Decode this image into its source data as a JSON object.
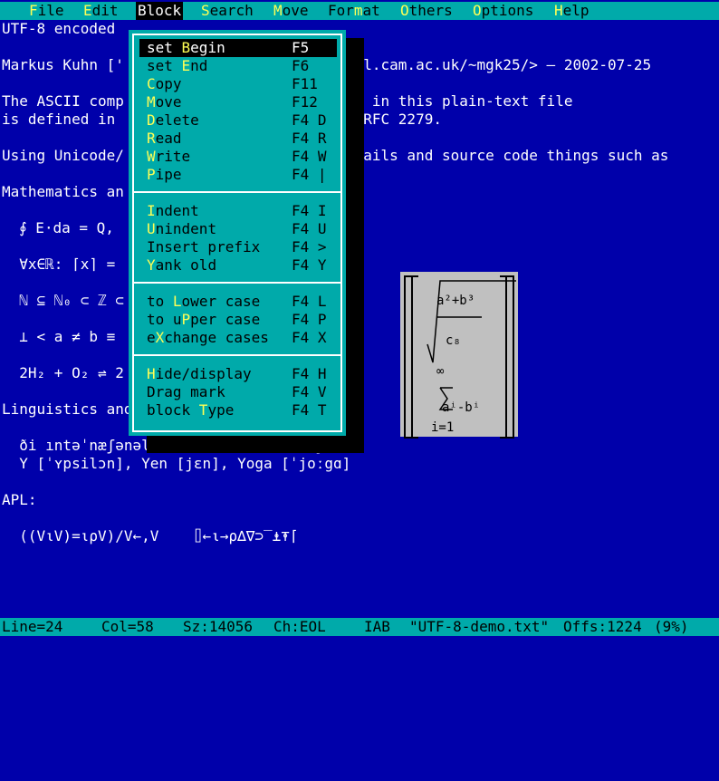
{
  "menubar": {
    "items": [
      {
        "pre": "",
        "hk": "F",
        "post": "ile"
      },
      {
        "pre": "",
        "hk": "E",
        "post": "dit"
      },
      {
        "pre": "",
        "hk": "B",
        "post": "lock"
      },
      {
        "pre": "",
        "hk": "S",
        "post": "earch"
      },
      {
        "pre": "",
        "hk": "M",
        "post": "ove"
      },
      {
        "pre": "For",
        "hk": "m",
        "post": "at"
      },
      {
        "pre": "",
        "hk": "O",
        "post": "thers"
      },
      {
        "pre": "",
        "hk": "O",
        "post": "ptions"
      },
      {
        "pre": "",
        "hk": "H",
        "post": "elp"
      }
    ],
    "active": "Block"
  },
  "document": {
    "lines": [
      "UTF-8 encoded",
      "",
      "Markus Kuhn ['",
      "",
      "The ASCII comp",
      "is defined in",
      "",
      "Using Unicode/",
      "",
      "Mathematics an",
      "",
      "  ∮ E⋅da = Q,",
      "",
      "  ∀x∈ℝ: ⌈x⌉ =",
      "",
      "  ℕ ⊆ ℕ₀ ⊂ ℤ ⊂",
      "",
      "  ⊥ < a ≠ b ≡",
      "",
      "  2H₂ + O₂ ⇌ 2",
      "",
      "Linguistics and dictionaries:",
      "",
      "  ði ıntəˈnæʃənəl fəˈnɛtık əsoʊsiˈeıʃn",
      "  Y [ˈʏpsilɔn], Yen [jɛn], Yoga [ˈjoːgɑ]",
      "",
      "APL:",
      "",
      "  ((V⍳V)=⍳⍴V)/V←,V    ⌷←⍳→⍴∆∇⊃‾⍎⍕⌈",
      ""
    ],
    "right_fragments": [
      {
        "row": 2,
        "text": ".cl.cam.ac.uk/~mgk25/> — 2002-07-25"
      },
      {
        "row": 4,
        "text": "ed in this plain-text file"
      },
      {
        "row": 5,
        "text": "d RFC 2279."
      },
      {
        "row": 7,
        "text": "emails and source code things such as"
      },
      {
        "row": 13,
        "text": "),"
      },
      {
        "row": 19,
        "text": "m"
      }
    ],
    "math_box": {
      "numerator": "a²+b³",
      "denominator": "c₈",
      "infinity": "∞",
      "sum_body": "aⁱ-bⁱ",
      "sum_lower": "i=1"
    }
  },
  "block_menu": {
    "groups": [
      [
        {
          "pre": "set ",
          "hk": "B",
          "post": "egin",
          "key": "F5",
          "selected": true
        },
        {
          "pre": "set ",
          "hk": "E",
          "post": "nd",
          "key": "F6"
        },
        {
          "pre": "",
          "hk": "C",
          "post": "opy",
          "key": "F11"
        },
        {
          "pre": "",
          "hk": "M",
          "post": "ove",
          "key": "F12"
        },
        {
          "pre": "",
          "hk": "D",
          "post": "elete",
          "key": "F4 D"
        },
        {
          "pre": "",
          "hk": "R",
          "post": "ead",
          "key": "F4 R"
        },
        {
          "pre": "",
          "hk": "W",
          "post": "rite",
          "key": "F4 W"
        },
        {
          "pre": "",
          "hk": "P",
          "post": "ipe",
          "key": "F4 |"
        }
      ],
      [
        {
          "pre": "",
          "hk": "I",
          "post": "ndent",
          "key": "F4 I"
        },
        {
          "pre": "",
          "hk": "U",
          "post": "nindent",
          "key": "F4 U"
        },
        {
          "pre": "Insert prefix",
          "hk": "",
          "post": "",
          "key": "F4 >"
        },
        {
          "pre": "",
          "hk": "Y",
          "post": "ank old",
          "key": "F4 Y"
        }
      ],
      [
        {
          "pre": "to ",
          "hk": "L",
          "post": "ower case",
          "key": "F4 L"
        },
        {
          "pre": "to u",
          "hk": "P",
          "post": "per case",
          "key": "F4 P"
        },
        {
          "pre": "e",
          "hk": "X",
          "post": "change cases",
          "key": "F4 X"
        }
      ],
      [
        {
          "pre": "",
          "hk": "H",
          "post": "ide/display",
          "key": "F4 H"
        },
        {
          "pre": "Drag mark",
          "hk": "",
          "post": "",
          "key": "F4 V"
        },
        {
          "pre": "block ",
          "hk": "T",
          "post": "ype",
          "key": "F4 T"
        }
      ]
    ]
  },
  "statusbar": {
    "line": "Line=24",
    "col": "Col=58",
    "size": "Sz:14056",
    "ch": "Ch:EOL",
    "mode": "IAB",
    "file": "\"UTF-8-demo.txt\"",
    "offs": "Offs:1224",
    "pct": "(9%)"
  },
  "colors": {
    "background": "#0000aa",
    "menu": "#00aaaa",
    "hotkey": "#ffff55",
    "math_box": "#c0c0c0"
  }
}
